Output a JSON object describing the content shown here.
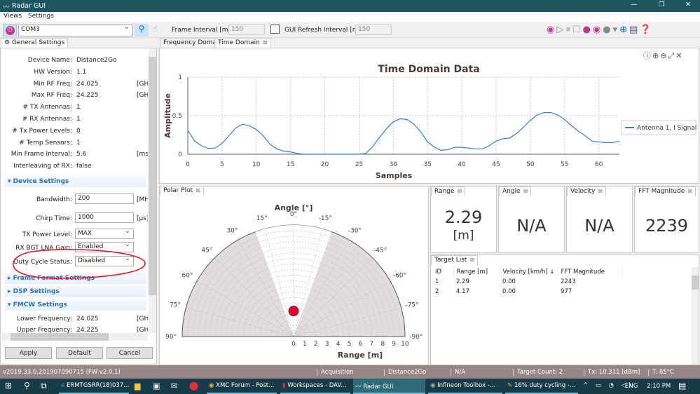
{
  "window": {
    "title": "Radar GUI"
  },
  "menu": [
    "Views",
    "Settings"
  ],
  "toolbar": {
    "port": "COM3",
    "frame_interval_label": "Frame Interval [ms]:",
    "frame_interval": "150",
    "gui_refresh_label": "GUI Refresh Interval [ms]:",
    "gui_refresh": "150",
    "icons": [
      "record-icon",
      "play-icon",
      "pause-icon",
      "stop-icon",
      "export-icon",
      "camera-icon",
      "document-icon",
      "globe-icon",
      "layout-icon",
      "help-icon"
    ]
  },
  "left": {
    "tab": "General Settings",
    "info": [
      {
        "label": "Device Name:",
        "value": "Distance2Go",
        "unit": ""
      },
      {
        "label": "HW Version:",
        "value": "1.1",
        "unit": ""
      },
      {
        "label": "Min RF Freq:",
        "value": "24.025",
        "unit": "[GH"
      },
      {
        "label": "Max RF Freq:",
        "value": "24.225",
        "unit": "[GH"
      },
      {
        "label": "# TX Antennas:",
        "value": "1",
        "unit": ""
      },
      {
        "label": "# RX Antennas:",
        "value": "1",
        "unit": ""
      },
      {
        "label": "# Tx Power Levels:",
        "value": "8",
        "unit": ""
      },
      {
        "label": "# Temp Sensors:",
        "value": "1",
        "unit": ""
      },
      {
        "label": "Min Frame Interval:",
        "value": "5.6",
        "unit": "[ms"
      },
      {
        "label": "Interleaving of RX:",
        "value": "false",
        "unit": ""
      }
    ],
    "device_settings": {
      "title": "Device Settings",
      "bandwidth_label": "Bandwidth:",
      "bandwidth": "200",
      "bandwidth_unit": "[MH",
      "chirp_label": "Chirp Time:",
      "chirp": "1000",
      "chirp_unit": "[µs]",
      "tx_power_label": "TX Power Level:",
      "tx_power": "MAX",
      "lna_label": "RX BGT LNA Gain:",
      "lna": "Enabled",
      "duty_label": "Duty Cycle Status:",
      "duty": "Disabled"
    },
    "frame_format": "Frame Format Settings",
    "dsp": "DSP Settings",
    "fmcw": {
      "title": "FMCW Settings",
      "lower_label": "Lower Frequency:",
      "lower": "24.025",
      "lower_unit": "[GH",
      "upper_label": "Upper Frequency:",
      "upper": "24.225",
      "upper_unit": "[GH"
    },
    "apply": "Apply",
    "default": "Default",
    "cancel": "Cancel"
  },
  "tabs": [
    "Frequency Domain",
    "Time Domain"
  ],
  "chart_data": [
    {
      "type": "line",
      "title": "Time Domain Data",
      "xlabel": "Samples",
      "ylabel": "Amplitude",
      "xlim": [
        0,
        63
      ],
      "ylim": [
        0,
        1
      ],
      "xticks": [
        0,
        5,
        10,
        15,
        20,
        25,
        30,
        35,
        40,
        45,
        50,
        55,
        60
      ],
      "yticks": [
        "0",
        "0.5",
        "1"
      ],
      "grid": true,
      "legend": "right",
      "series": [
        {
          "name": "Antenna 1, I Signal",
          "color": "#3a7fc4",
          "values": [
            0.31,
            0.17,
            0.11,
            0.075,
            0.08,
            0.14,
            0.24,
            0.34,
            0.39,
            0.37,
            0.32,
            0.24,
            0.13,
            0.07,
            0.04,
            0.03,
            0.01,
            0,
            0,
            0,
            0,
            0,
            0,
            0,
            0,
            0,
            0.01,
            0.1,
            0.22,
            0.33,
            0.42,
            0.46,
            0.45,
            0.39,
            0.29,
            0.16,
            0.09,
            0.05,
            0.06,
            0.09,
            0.09,
            0.08,
            0.07,
            0.07,
            0.11,
            0.17,
            0.2,
            0.21,
            0.27,
            0.35,
            0.44,
            0.51,
            0.54,
            0.54,
            0.51,
            0.45,
            0.37,
            0.3,
            0.24,
            0.17,
            0.16,
            0.15,
            0.15,
            0.17
          ]
        }
      ]
    },
    {
      "type": "scatter",
      "title": "Angle [°]",
      "xlabel": "Range [m]",
      "range_ticks": [
        "0",
        "1",
        "2",
        "3",
        "4",
        "5",
        "6",
        "7",
        "8",
        "9",
        "10"
      ],
      "range_max": 10,
      "angle_ticks": [
        "90°",
        "75°",
        "60°",
        "45°",
        "30°",
        "15°",
        "0°",
        "-15°",
        "-30°",
        "-45°",
        "-60°",
        "-75°",
        "-90°"
      ],
      "field_of_view_deg": 20,
      "points": [
        {
          "range": 2.29,
          "angle": 0,
          "color": "#dc0a32"
        }
      ]
    }
  ],
  "panels": {
    "polar": "Polar Plot",
    "range": {
      "title": "Range",
      "value": "2.29",
      "unit": "[m]"
    },
    "angle": {
      "title": "Angle",
      "value": "N/A"
    },
    "velocity": {
      "title": "Velocity",
      "value": "N/A"
    },
    "fft": {
      "title": "FFT Magnitude",
      "value": "2239"
    }
  },
  "targets": {
    "title": "Target List",
    "columns": [
      "ID",
      "Range [m]",
      "Velocity [km/h] ↓",
      "FFT Magnitude"
    ],
    "rows": [
      [
        "1",
        "2.29",
        "0.00",
        "2243"
      ],
      [
        "2",
        "4.17",
        "0.00",
        "977"
      ]
    ]
  },
  "status": {
    "version": "v2019.33.0.201907090715 (FW v2.0.1)",
    "mode": "Acquisition",
    "device": "Distance2Go",
    "na": "N/A",
    "targets": "Target Count: 2",
    "tx": "Tx: 10.311 [dBm]",
    "temp": "T: 85°C"
  },
  "taskbar": {
    "apps": [
      "ERMTGSRR(18)037...",
      "XMC Forum - Post...",
      "Workspaces - DAV...",
      "Radar GUI",
      "Infineon Toolbox -...",
      "16% duty cycling -..."
    ],
    "lang": "ENG",
    "time": "2:10 PM"
  }
}
